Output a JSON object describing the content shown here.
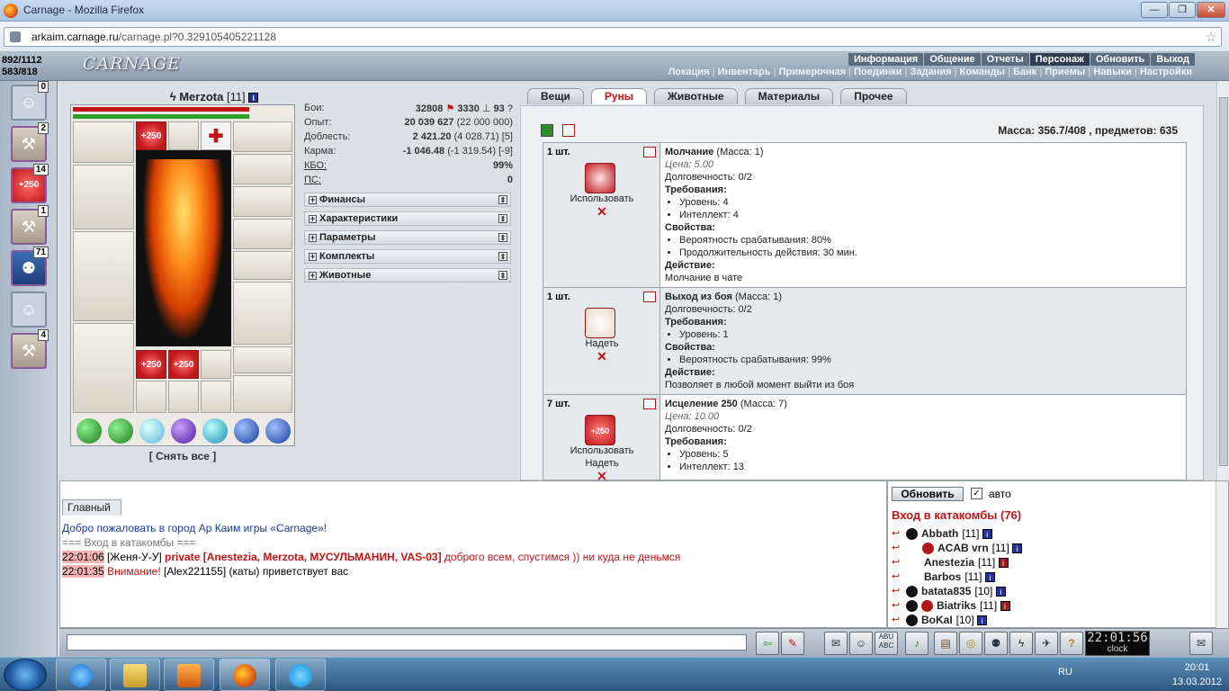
{
  "window": {
    "title": "Carnage - Mozilla Firefox",
    "min": "—",
    "max": "❐",
    "close": "✕"
  },
  "url": {
    "host": "arkaim.carnage.ru",
    "path": "/carnage.pl?0.329105405221128"
  },
  "hud": {
    "hp": "892/1112",
    "mp": "583/818",
    "logo": "CARNAGE"
  },
  "topmenu": [
    "Информация",
    "Общение",
    "Отчеты",
    "Персонаж",
    "Обновить",
    "Выход"
  ],
  "submenu": [
    "Локация",
    "Инвентарь",
    "Примерочная",
    "Поединки",
    "Задания",
    "Команды",
    "Банк",
    "Приемы",
    "Навыки",
    "Настройки"
  ],
  "leftbar": [
    {
      "icon": "person-icon",
      "count": "0"
    },
    {
      "icon": "scroll-icon",
      "count": "2"
    },
    {
      "icon": "heal-250-icon",
      "count": "14",
      "label": "+250"
    },
    {
      "icon": "scroll-icon",
      "count": "1"
    },
    {
      "icon": "group-icon",
      "count": "71"
    },
    {
      "icon": "person-icon",
      "count": ""
    },
    {
      "icon": "scroll-icon",
      "count": "4"
    }
  ],
  "character": {
    "name": "Merzota",
    "level": "[11]",
    "info": "i",
    "remove_all": "[ Снять все ]"
  },
  "stats": [
    {
      "label": "Бои:",
      "value": "32808",
      "extra1": "3330",
      "extra2": "93",
      "extra3": "?"
    },
    {
      "label": "Опыт:",
      "value": "20 039 627",
      "extra": "(22 000 000)"
    },
    {
      "label": "Доблесть:",
      "value": "2 421.20",
      "extra": "(4 028.71) [5]"
    },
    {
      "label": "Карма:",
      "value": "-1 046.48",
      "extra": "(-1 319.54) [-9]"
    },
    {
      "label": "КБО:",
      "value": "99%",
      "extra": ""
    },
    {
      "label": "ПС:",
      "value": "0",
      "extra": ""
    }
  ],
  "sections": [
    "Финансы",
    "Характеристики",
    "Параметры",
    "Комплекты",
    "Животные"
  ],
  "tabs": [
    "Вещи",
    "Руны",
    "Животные",
    "Материалы",
    "Прочее"
  ],
  "massa": "Масса: 356.7/408 , предметов: 635",
  "items": [
    {
      "qty": "1 шт.",
      "actions": [
        "Использовать"
      ],
      "name": "Молчание",
      "mass": "(Масса: 1)",
      "price": "Цена: 5.00",
      "durability": "Долговечность: 0/2",
      "req_title": "Требования:",
      "reqs": [
        "Уровень: 4",
        "Интеллект: 4"
      ],
      "props_title": "Свойства:",
      "props": [
        "Вероятность срабатывания: 80%",
        "Продолжительность действия: 30 мин."
      ],
      "act_title": "Действие:",
      "act": "Молчание в чате"
    },
    {
      "qty": "1 шт.",
      "actions": [
        "Надеть"
      ],
      "name": "Выход из боя",
      "mass": "(Масса: 1)",
      "price": "",
      "durability": "Долговечность: 0/2",
      "req_title": "Требования:",
      "reqs": [
        "Уровень: 1"
      ],
      "props_title": "Свойства:",
      "props": [
        "Вероятность срабатывания: 99%"
      ],
      "act_title": "Действие:",
      "act": "Позволяет в любой момент выйти из боя"
    },
    {
      "qty": "7 шт.",
      "actions": [
        "Использовать",
        "Надеть"
      ],
      "name": "Исцеление 250",
      "mass": "(Масса: 7)",
      "price": "Цена: 10.00",
      "durability": "Долговечность: 0/2",
      "req_title": "Требования:",
      "reqs": [
        "Уровень: 5",
        "Интеллект: 13"
      ],
      "props_title": "",
      "props": [],
      "act_title": "",
      "act": ""
    }
  ],
  "chat": {
    "tab": "Главный",
    "welcome": "Добро пожаловать в город Ар Каим игры «Carnage»!",
    "channel": "=== Вход в катакомбы ===",
    "line1": {
      "time": "22:01:06",
      "nick": "Женя-У-У",
      "pvt": "private [Anestezia, Merzota, МУСУЛЬМАНИН, VAS-03]",
      "text": "доброго всем, спустимся )) ни куда не деньмся"
    },
    "line2": {
      "time": "22:01:35",
      "warn": "Внимание!",
      "nick": "Alex221155",
      "text": "(каты) приветствует вас"
    }
  },
  "online": {
    "refresh": "Обновить",
    "auto": "авто",
    "title": "Вход в катакомбы (76)",
    "players": [
      {
        "name": "Abbath",
        "level": "[11]"
      },
      {
        "name": "ACAB vrn",
        "level": "[11]"
      },
      {
        "name": "Anestezia",
        "level": "[11]"
      },
      {
        "name": "Barbos",
        "level": "[11]"
      },
      {
        "name": "batata835",
        "level": "[10]"
      },
      {
        "name": "Biatriks",
        "level": "[11]"
      },
      {
        "name": "BoKaI",
        "level": "[10]"
      }
    ]
  },
  "clock": {
    "time": "22:01:56",
    "label": "clock"
  },
  "taskbar": {
    "lang": "RU",
    "time": "20:01",
    "date": "13.03.2012"
  }
}
